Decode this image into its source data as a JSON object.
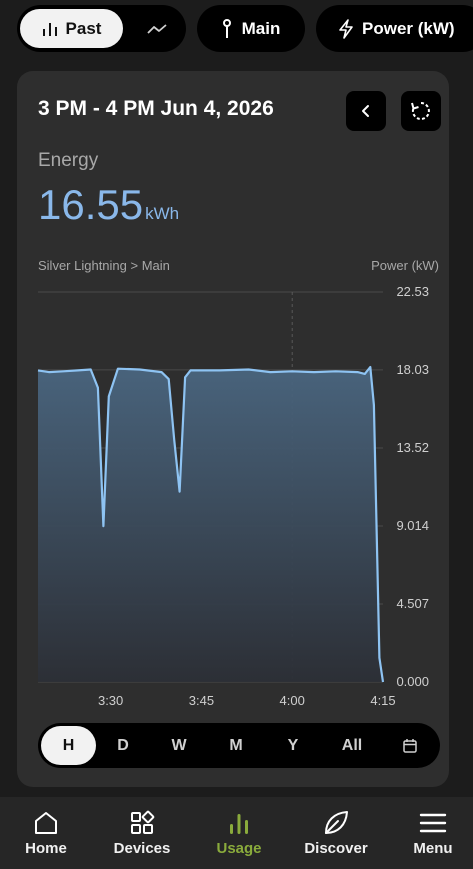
{
  "topbar": {
    "past_label": "Past",
    "main_label": "Main",
    "power_label": "Power (kW)"
  },
  "card": {
    "range_title": "3 PM - 4 PM Jun 4, 2026",
    "energy_label": "Energy",
    "energy_value": "16.55",
    "energy_unit": "kWh",
    "breadcrumb": "Silver Lightning > Main",
    "y_axis_title": "Power (kW)"
  },
  "chart_data": {
    "type": "area",
    "ylabel": "Power (kW)",
    "y_ticks": [
      "22.53",
      "18.03",
      "13.52",
      "9.014",
      "4.507",
      "0.000"
    ],
    "ylim": [
      0,
      22.53
    ],
    "x_ticks": [
      {
        "label": "3:30",
        "t": 3.5
      },
      {
        "label": "3:45",
        "t": 3.75
      },
      {
        "label": "4:00",
        "t": 4.0
      },
      {
        "label": "4:15",
        "t": 4.25
      }
    ],
    "xlim": [
      3.3,
      4.25
    ],
    "grid": true,
    "accent_color": "#8ec3f2",
    "series": [
      {
        "x": [
          3.3,
          3.33,
          3.37,
          3.41,
          3.445,
          3.465,
          3.48,
          3.495,
          3.52,
          3.58,
          3.64,
          3.66,
          3.675,
          3.69,
          3.705,
          3.72,
          3.8,
          3.88,
          3.94,
          4.0,
          4.06,
          4.12,
          4.18,
          4.2,
          4.215,
          4.225,
          4.24,
          4.25
        ],
        "y": [
          18.0,
          17.9,
          17.95,
          18.0,
          18.05,
          17.0,
          9.0,
          16.5,
          18.1,
          18.05,
          17.9,
          17.5,
          14.0,
          11.0,
          17.6,
          18.0,
          18.0,
          18.05,
          17.9,
          17.95,
          17.9,
          17.95,
          17.9,
          17.8,
          18.2,
          16.0,
          1.4,
          0.0
        ]
      }
    ]
  },
  "range_buttons": [
    "H",
    "D",
    "W",
    "M",
    "Y",
    "All"
  ],
  "nav": {
    "items": [
      "Home",
      "Devices",
      "Usage",
      "Discover",
      "Menu"
    ]
  }
}
